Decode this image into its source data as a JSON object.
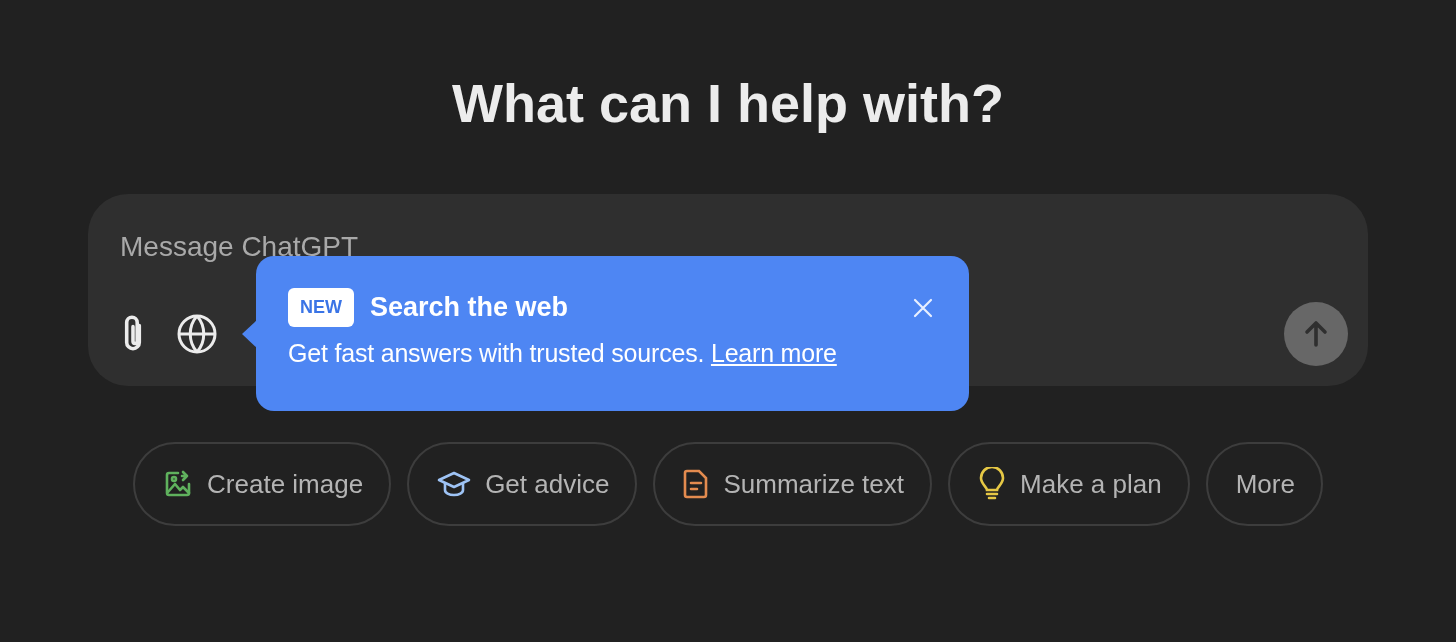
{
  "heading": "What can I help with?",
  "composer": {
    "placeholder": "Message ChatGPT",
    "send_disabled": true
  },
  "tooltip": {
    "badge": "NEW",
    "title": "Search the web",
    "body": "Get fast answers with trusted sources.",
    "link": "Learn more"
  },
  "chips": [
    {
      "label": "Create image",
      "kind": "image",
      "color": "#5fb15d"
    },
    {
      "label": "Get advice",
      "kind": "cap",
      "color": "#9ec3f5"
    },
    {
      "label": "Summarize text",
      "kind": "doc",
      "color": "#e38b4f"
    },
    {
      "label": "Make a plan",
      "kind": "bulb",
      "color": "#e6c845"
    },
    {
      "label": "More",
      "kind": "none"
    }
  ]
}
